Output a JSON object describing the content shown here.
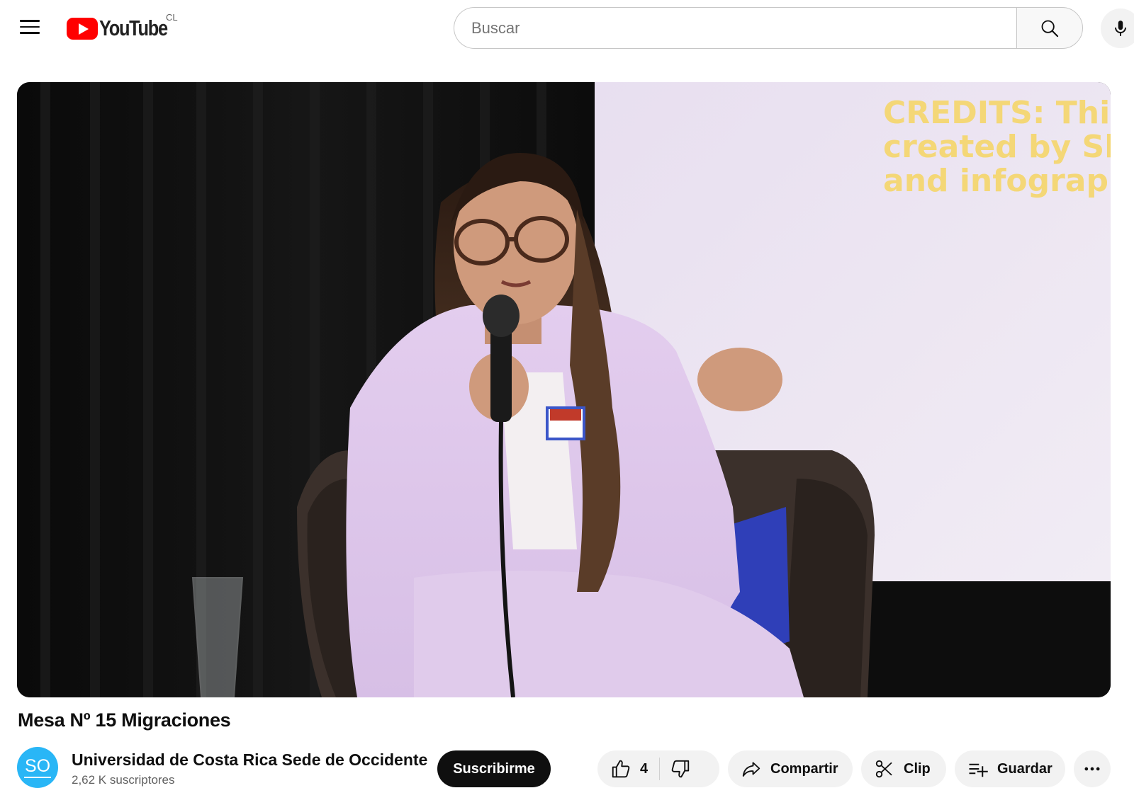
{
  "header": {
    "logo_text": "YouTube",
    "country_code": "CL",
    "search_placeholder": "Buscar"
  },
  "slide_text": [
    "CREDITS: This pr",
    "created by Slide",
    "and infographic"
  ],
  "video": {
    "title": "Mesa Nº 15 Migraciones"
  },
  "channel": {
    "avatar_initials": "SO",
    "name": "Universidad de Costa Rica Sede de Occidente",
    "subscribers": "2,62 K suscriptores",
    "subscribe_label": "Suscribirme"
  },
  "actions": {
    "like_count": "4",
    "share_label": "Compartir",
    "clip_label": "Clip",
    "save_label": "Guardar"
  },
  "colors": {
    "brand_red": "#ff0000",
    "avatar_bg": "#29b6f6",
    "subscribe_bg": "#0f0f0f",
    "pill_bg": "#f2f2f2"
  }
}
